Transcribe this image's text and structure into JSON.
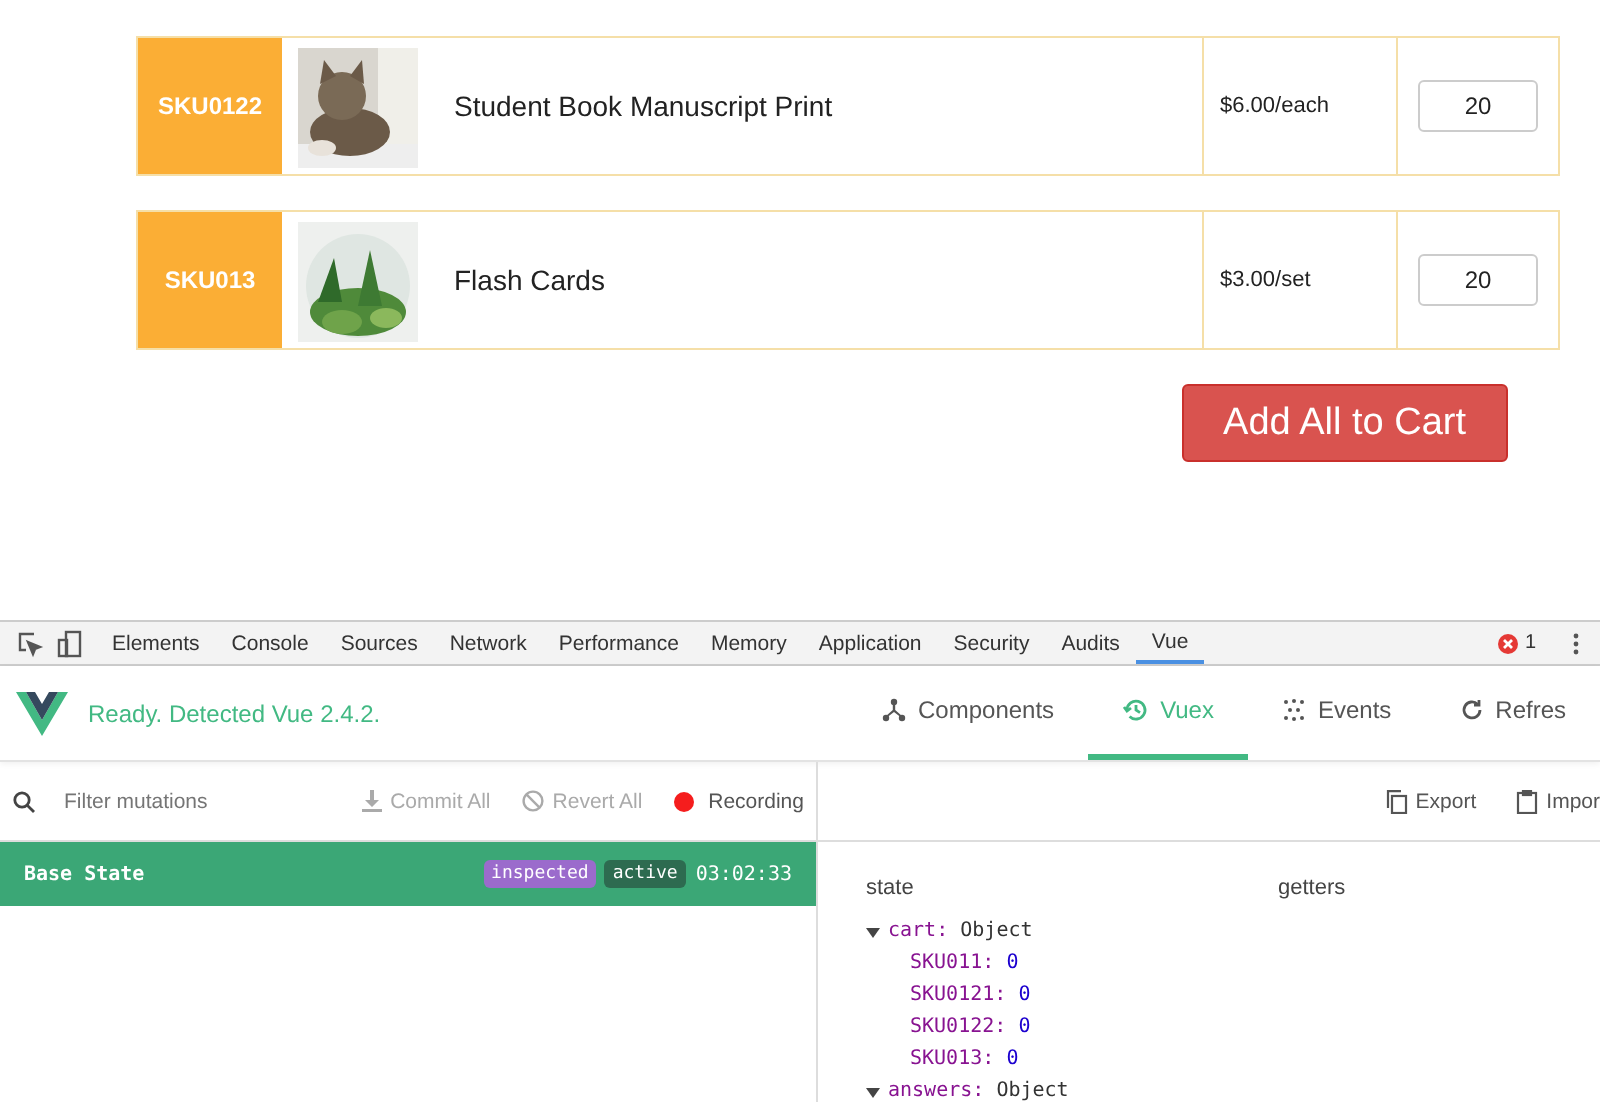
{
  "products": [
    {
      "sku": "SKU0122",
      "name": "Student Book Manuscript Print",
      "price": "$6.00/each",
      "quantity": "20"
    },
    {
      "sku": "SKU013",
      "name": "Flash Cards",
      "price": "$3.00/set",
      "quantity": "20"
    }
  ],
  "add_button": "Add All to Cart",
  "devtools": {
    "tabs": [
      {
        "label": "Elements",
        "selected": false
      },
      {
        "label": "Console",
        "selected": false
      },
      {
        "label": "Sources",
        "selected": false
      },
      {
        "label": "Network",
        "selected": false
      },
      {
        "label": "Performance",
        "selected": false
      },
      {
        "label": "Memory",
        "selected": false
      },
      {
        "label": "Application",
        "selected": false
      },
      {
        "label": "Security",
        "selected": false
      },
      {
        "label": "Audits",
        "selected": false
      },
      {
        "label": "Vue",
        "selected": true
      }
    ],
    "error_count": "1",
    "status": "Ready. Detected Vue 2.4.2.",
    "nav": [
      {
        "kind": "components",
        "label": "Components",
        "selected": false
      },
      {
        "kind": "vuex",
        "label": "Vuex",
        "selected": true
      },
      {
        "kind": "events",
        "label": "Events",
        "selected": false
      },
      {
        "kind": "refresh",
        "label": "Refres",
        "selected": false
      }
    ],
    "filter": {
      "placeholder": "Filter mutations"
    },
    "commit_all": {
      "label": "Commit All",
      "disabled": true
    },
    "revert_all": {
      "label": "Revert All",
      "disabled": true
    },
    "recording": "Recording",
    "export": "Export",
    "import": "Impor",
    "mutations": [
      {
        "name": "Base State",
        "badges": [
          "inspected",
          "active"
        ],
        "time": "03:02:33",
        "selected": true
      }
    ],
    "state_heading": "state",
    "getters_heading": "getters",
    "state": [
      {
        "key": "cart:",
        "value": "Object",
        "expanded": true,
        "children": [
          {
            "key": "SKU011:",
            "value": "0"
          },
          {
            "key": "SKU0121:",
            "value": "0"
          },
          {
            "key": "SKU0122:",
            "value": "0"
          },
          {
            "key": "SKU013:",
            "value": "0"
          }
        ]
      },
      {
        "key": "answers:",
        "value": "Object",
        "expanded": true
      }
    ]
  }
}
